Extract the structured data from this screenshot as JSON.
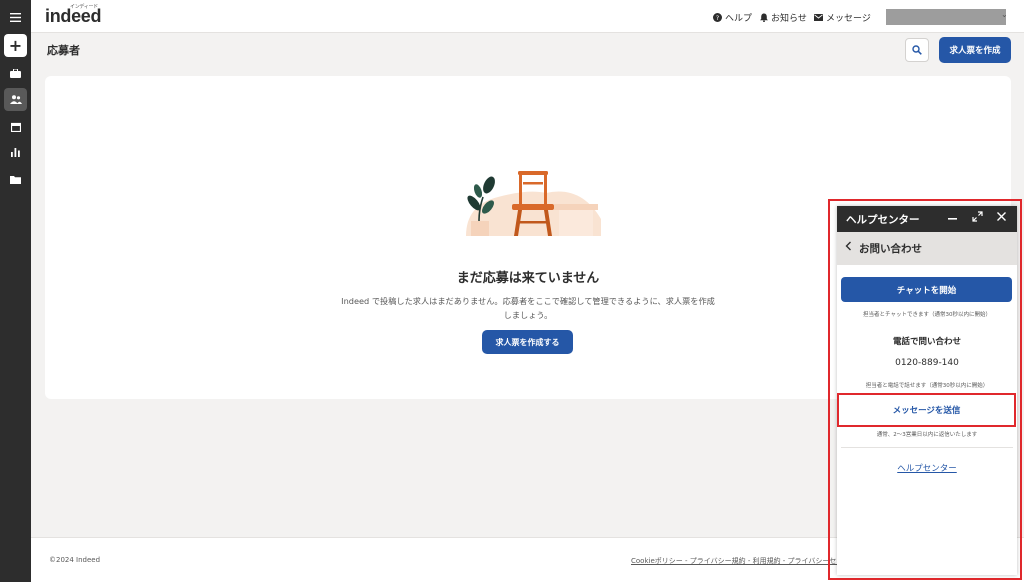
{
  "header": {
    "logo": "indeed",
    "logo_kana": "インディード",
    "help": "ヘルプ",
    "notifications": "お知らせ",
    "messages": "メッセージ"
  },
  "page": {
    "title": "応募者",
    "create_button": "求人票を作成"
  },
  "empty_state": {
    "title": "まだ応募は来ていません",
    "description": "Indeed で投稿した求人はまだありません。応募者をここで確認して管理できるように、求人票を作成しましょう。",
    "button": "求人票を作成する"
  },
  "help_center": {
    "title": "ヘルプセンター",
    "subtitle": "お問い合わせ",
    "chat_button": "チャットを開始",
    "chat_note": "担当者とチャットできます（通常30秒以内に開始）",
    "phone_title": "電話で問い合わせ",
    "phone_number": "0120-889-140",
    "phone_note": "担当者と電話で話せます（通常30秒以内に開始）",
    "message_button": "メッセージを送信",
    "message_note": "通常、2～3営業日以内に返信いたします",
    "help_link": "ヘルプセンター"
  },
  "footer": {
    "copyright": "©2024 Indeed",
    "links": "Cookieポリシー - プライバシー規約 - 利用規約 - プライバシーセン"
  },
  "colors": {
    "primary": "#2557a7",
    "rail": "#2d2d2d",
    "highlight": "#e0282c",
    "chair": "#d9692a"
  }
}
